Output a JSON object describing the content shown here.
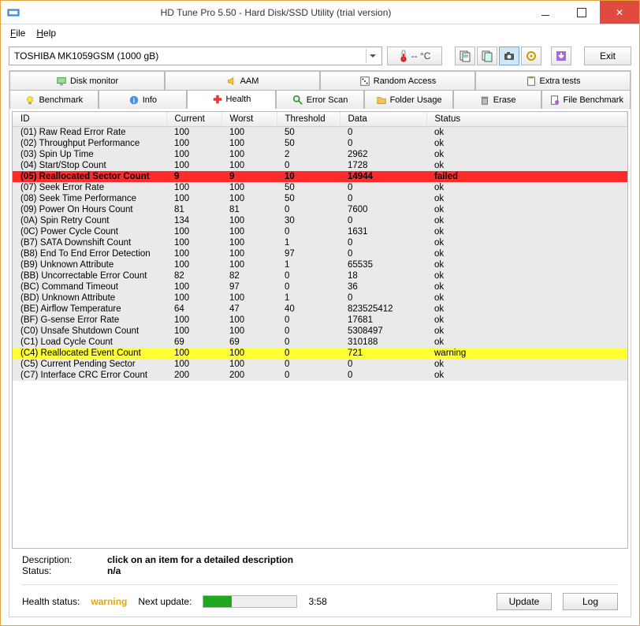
{
  "window": {
    "title": "HD Tune Pro 5.50 - Hard Disk/SSD Utility (trial version)"
  },
  "menu": {
    "file": "File",
    "help": "Help"
  },
  "toolbar": {
    "device": "TOSHIBA MK1059GSM (1000 gB)",
    "temp": "-- °C",
    "exit": "Exit"
  },
  "tabs_top": [
    {
      "label": "Disk monitor"
    },
    {
      "label": "AAM"
    },
    {
      "label": "Random Access"
    },
    {
      "label": "Extra tests"
    }
  ],
  "tabs_bottom": [
    {
      "label": "Benchmark"
    },
    {
      "label": "Info"
    },
    {
      "label": "Health"
    },
    {
      "label": "Error Scan"
    },
    {
      "label": "Folder Usage"
    },
    {
      "label": "Erase"
    },
    {
      "label": "File Benchmark"
    }
  ],
  "grid": {
    "headers": {
      "id": "ID",
      "current": "Current",
      "worst": "Worst",
      "threshold": "Threshold",
      "data": "Data",
      "status": "Status"
    },
    "rows": [
      {
        "id": "(01) Raw Read Error Rate",
        "cur": "100",
        "worst": "100",
        "th": "50",
        "data": "0",
        "status": "ok",
        "cls": "alt"
      },
      {
        "id": "(02) Throughput Performance",
        "cur": "100",
        "worst": "100",
        "th": "50",
        "data": "0",
        "status": "ok",
        "cls": "alt"
      },
      {
        "id": "(03) Spin Up Time",
        "cur": "100",
        "worst": "100",
        "th": "2",
        "data": "2962",
        "status": "ok",
        "cls": "alt"
      },
      {
        "id": "(04) Start/Stop Count",
        "cur": "100",
        "worst": "100",
        "th": "0",
        "data": "1728",
        "status": "ok",
        "cls": "alt"
      },
      {
        "id": "(05) Reallocated Sector Count",
        "cur": "9",
        "worst": "9",
        "th": "10",
        "data": "14944",
        "status": "failed",
        "cls": "failed"
      },
      {
        "id": "(07) Seek Error Rate",
        "cur": "100",
        "worst": "100",
        "th": "50",
        "data": "0",
        "status": "ok",
        "cls": "alt"
      },
      {
        "id": "(08) Seek Time Performance",
        "cur": "100",
        "worst": "100",
        "th": "50",
        "data": "0",
        "status": "ok",
        "cls": "alt"
      },
      {
        "id": "(09) Power On Hours Count",
        "cur": "81",
        "worst": "81",
        "th": "0",
        "data": "7600",
        "status": "ok",
        "cls": "alt"
      },
      {
        "id": "(0A) Spin Retry Count",
        "cur": "134",
        "worst": "100",
        "th": "30",
        "data": "0",
        "status": "ok",
        "cls": "alt"
      },
      {
        "id": "(0C) Power Cycle Count",
        "cur": "100",
        "worst": "100",
        "th": "0",
        "data": "1631",
        "status": "ok",
        "cls": "alt"
      },
      {
        "id": "(B7) SATA Downshift Count",
        "cur": "100",
        "worst": "100",
        "th": "1",
        "data": "0",
        "status": "ok",
        "cls": "alt"
      },
      {
        "id": "(B8) End To End Error Detection",
        "cur": "100",
        "worst": "100",
        "th": "97",
        "data": "0",
        "status": "ok",
        "cls": "alt"
      },
      {
        "id": "(B9) Unknown Attribute",
        "cur": "100",
        "worst": "100",
        "th": "1",
        "data": "65535",
        "status": "ok",
        "cls": "alt"
      },
      {
        "id": "(BB) Uncorrectable Error Count",
        "cur": "82",
        "worst": "82",
        "th": "0",
        "data": "18",
        "status": "ok",
        "cls": "alt"
      },
      {
        "id": "(BC) Command Timeout",
        "cur": "100",
        "worst": "97",
        "th": "0",
        "data": "36",
        "status": "ok",
        "cls": "alt"
      },
      {
        "id": "(BD) Unknown Attribute",
        "cur": "100",
        "worst": "100",
        "th": "1",
        "data": "0",
        "status": "ok",
        "cls": "alt"
      },
      {
        "id": "(BE) Airflow Temperature",
        "cur": "64",
        "worst": "47",
        "th": "40",
        "data": "823525412",
        "status": "ok",
        "cls": "alt"
      },
      {
        "id": "(BF) G-sense Error Rate",
        "cur": "100",
        "worst": "100",
        "th": "0",
        "data": "17681",
        "status": "ok",
        "cls": "alt"
      },
      {
        "id": "(C0) Unsafe Shutdown Count",
        "cur": "100",
        "worst": "100",
        "th": "0",
        "data": "5308497",
        "status": "ok",
        "cls": "alt"
      },
      {
        "id": "(C1) Load Cycle Count",
        "cur": "69",
        "worst": "69",
        "th": "0",
        "data": "310188",
        "status": "ok",
        "cls": "alt"
      },
      {
        "id": "(C4) Reallocated Event Count",
        "cur": "100",
        "worst": "100",
        "th": "0",
        "data": "721",
        "status": "warning",
        "cls": "warning"
      },
      {
        "id": "(C5) Current Pending Sector",
        "cur": "100",
        "worst": "100",
        "th": "0",
        "data": "0",
        "status": "ok",
        "cls": "alt"
      },
      {
        "id": "(C7) Interface CRC Error Count",
        "cur": "200",
        "worst": "200",
        "th": "0",
        "data": "0",
        "status": "ok",
        "cls": "alt"
      }
    ]
  },
  "bottom": {
    "desc_label": "Description:",
    "desc_value": "click on an item for a detailed description",
    "status_label": "Status:",
    "status_value": "n/a",
    "health_label": "Health status:",
    "health_value": "warning",
    "next_update_label": "Next update:",
    "next_update_time": "3:58",
    "update_btn": "Update",
    "log_btn": "Log"
  }
}
